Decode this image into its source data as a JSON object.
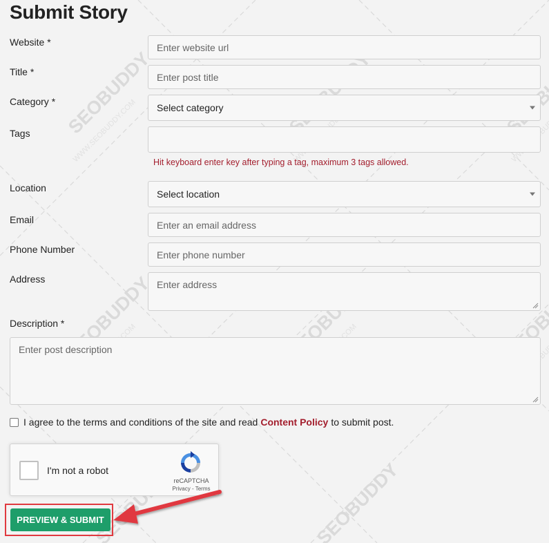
{
  "page": {
    "title": "Submit Story"
  },
  "form": {
    "website": {
      "label": "Website *",
      "placeholder": "Enter website url"
    },
    "title": {
      "label": "Title *",
      "placeholder": "Enter post title"
    },
    "category": {
      "label": "Category *",
      "value": "Select category"
    },
    "tags": {
      "label": "Tags",
      "hint": "Hit keyboard enter key after typing a tag, maximum 3 tags allowed."
    },
    "location": {
      "label": "Location",
      "value": "Select location"
    },
    "email": {
      "label": "Email",
      "placeholder": "Enter an email address"
    },
    "phone": {
      "label": "Phone Number",
      "placeholder": "Enter phone number"
    },
    "address": {
      "label": "Address",
      "placeholder": "Enter address"
    },
    "description": {
      "label": "Description *",
      "placeholder": "Enter post description"
    }
  },
  "agreement": {
    "text_before": "I agree to the terms and conditions of the site and read",
    "link": "Content Policy",
    "text_after": "to submit post."
  },
  "captcha": {
    "label": "I'm not a robot",
    "brand": "reCAPTCHA",
    "links": "Privacy - Terms"
  },
  "submit": {
    "label": "PREVIEW & SUBMIT"
  },
  "watermark": {
    "brand": "SEOBUDDY",
    "domain": "WWW.SEOBUDDY.COM"
  },
  "colors": {
    "accent": "#1e9e6a",
    "hint": "#a31e2d",
    "highlight": "#e0393f"
  }
}
